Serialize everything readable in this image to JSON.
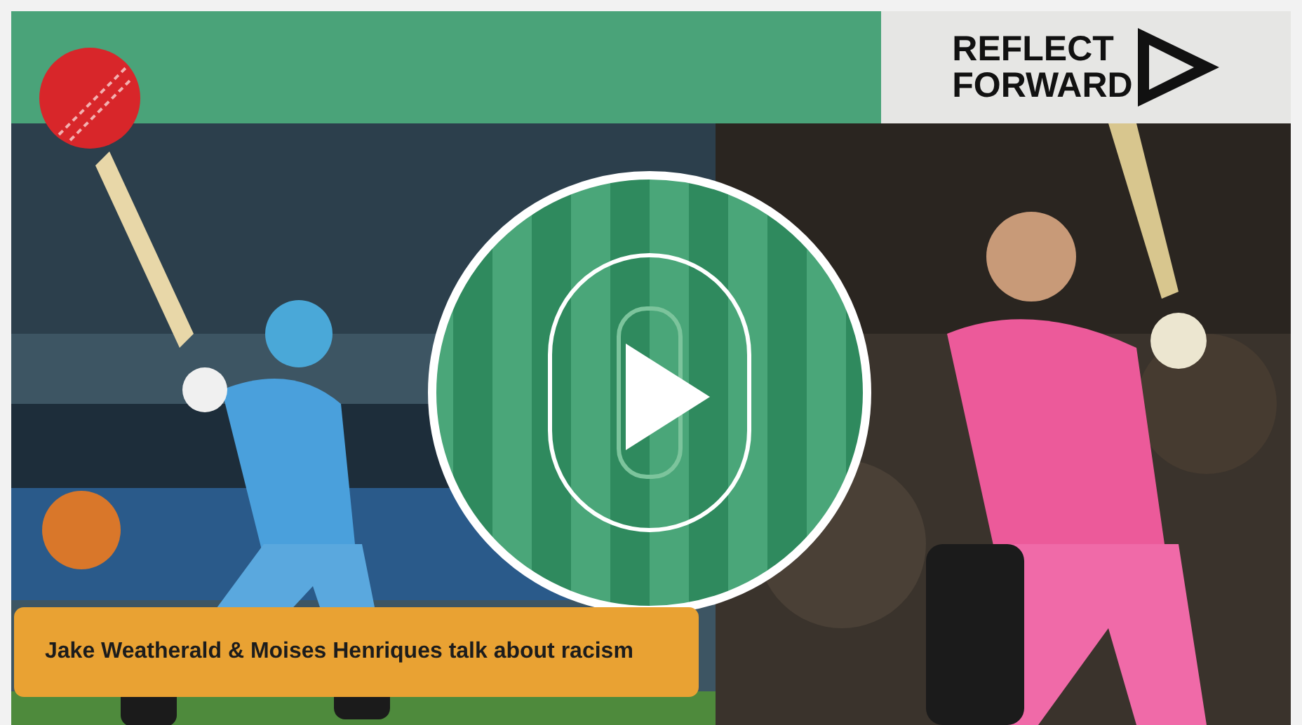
{
  "logo": {
    "lines": [
      "REFLECT",
      "FORWARD"
    ]
  },
  "video": {
    "caption": "Jake Weatherald & Moises Henriques talk about racism"
  }
}
